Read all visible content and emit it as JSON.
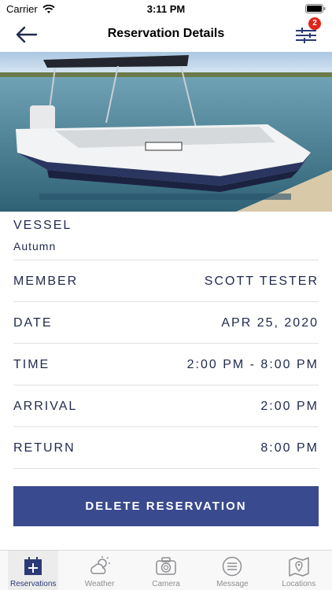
{
  "status": {
    "carrier": "Carrier",
    "time": "3:11 PM"
  },
  "nav": {
    "title": "Reservation Details",
    "filter_badge": "2"
  },
  "vessel": {
    "label": "VESSEL",
    "value": "Autumn"
  },
  "details": [
    {
      "label": "MEMBER",
      "value": "SCOTT TESTER"
    },
    {
      "label": "DATE",
      "value": "APR 25, 2020"
    },
    {
      "label": "TIME",
      "value": "2:00 PM - 8:00 PM"
    },
    {
      "label": "ARRIVAL",
      "value": "2:00 PM"
    },
    {
      "label": "RETURN",
      "value": "8:00 PM"
    }
  ],
  "delete_button": {
    "label": "DELETE RESERVATION"
  },
  "tabs": [
    {
      "label": "Reservations",
      "icon": "calendar-add-icon",
      "active": true
    },
    {
      "label": "Weather",
      "icon": "weather-icon",
      "active": false
    },
    {
      "label": "Camera",
      "icon": "camera-icon",
      "active": false
    },
    {
      "label": "Message",
      "icon": "message-icon",
      "active": false
    },
    {
      "label": "Locations",
      "icon": "map-pin-icon",
      "active": false
    }
  ],
  "colors": {
    "accent": "#3a4a8e",
    "text": "#1f2a4d",
    "badge": "#e0261b"
  }
}
